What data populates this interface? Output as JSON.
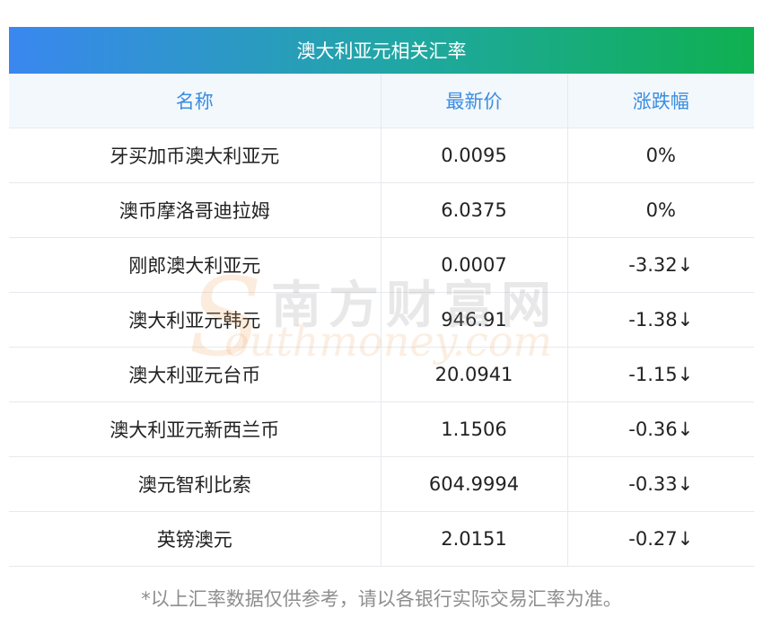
{
  "title": "澳大利亚元相关汇率",
  "headers": {
    "name": "名称",
    "price": "最新价",
    "change": "涨跌幅"
  },
  "rows": [
    {
      "name": "牙买加币澳大利亚元",
      "price": "0.0095",
      "change": "0%",
      "trend": "flat"
    },
    {
      "name": "澳币摩洛哥迪拉姆",
      "price": "6.0375",
      "change": "0%",
      "trend": "flat"
    },
    {
      "name": "刚郎澳大利亚元",
      "price": "0.0007",
      "change": "-3.32↓",
      "trend": "down"
    },
    {
      "name": "澳大利亚元韩元",
      "price": "946.91",
      "change": "-1.38↓",
      "trend": "down"
    },
    {
      "name": "澳大利亚元台币",
      "price": "20.0941",
      "change": "-1.15↓",
      "trend": "down"
    },
    {
      "name": "澳大利亚元新西兰币",
      "price": "1.1506",
      "change": "-0.36↓",
      "trend": "down"
    },
    {
      "name": "澳元智利比索",
      "price": "604.9994",
      "change": "-0.33↓",
      "trend": "down"
    },
    {
      "name": "英镑澳元",
      "price": "2.0151",
      "change": "-0.27↓",
      "trend": "down"
    }
  ],
  "watermark": {
    "cn": "南方财富网",
    "en_s": "S",
    "en_rest": "outhmoney.com"
  },
  "footnote": "*以上汇率数据仅供参考，请以各银行实际交易汇率为准。",
  "colors": {
    "header_text": "#3a8de0",
    "down": "#1a8c1a",
    "title_gradient_start": "#3a87f0",
    "title_gradient_end": "#0fb050"
  }
}
